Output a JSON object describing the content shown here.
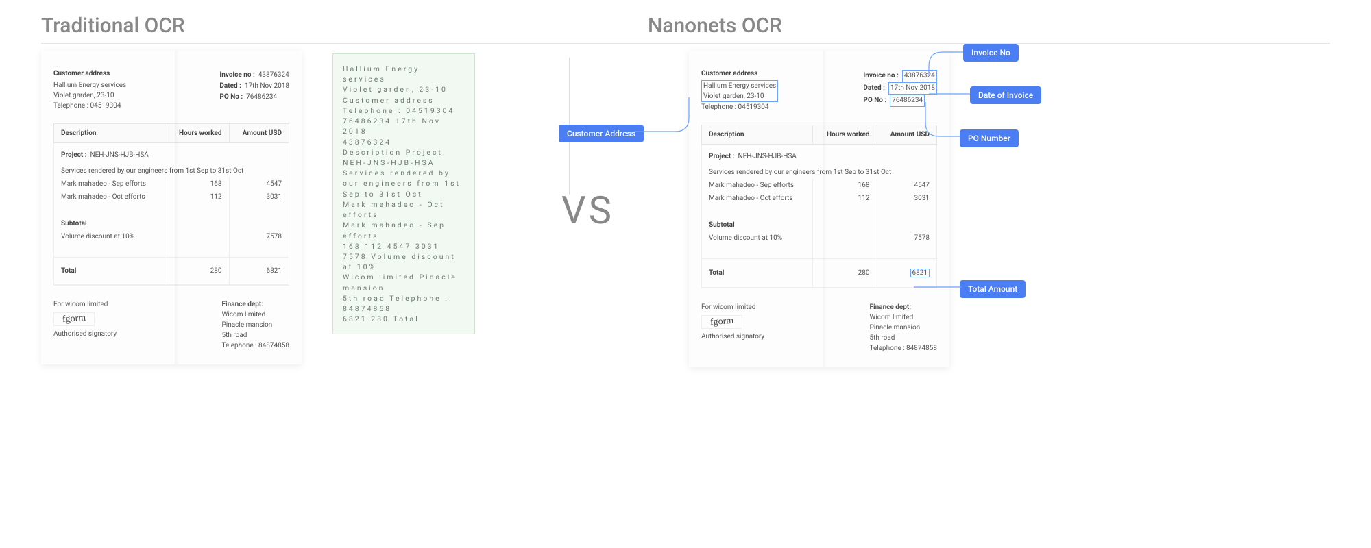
{
  "headings": {
    "left": "Traditional OCR",
    "right": "Nanonets OCR"
  },
  "vs": "VS",
  "invoice": {
    "customer_title": "Customer address",
    "addr1": "Hallium Energy services",
    "addr2": "Violet garden, 23-10",
    "addr3": "Telephone : 04519304",
    "k_invno": "Invoice no :",
    "v_invno": "43876324",
    "k_dated": "Dated :",
    "v_dated": "17th Nov 2018",
    "k_pono": "PO No :",
    "v_pono": "76486234",
    "th_desc": "Description",
    "th_hours": "Hours worked",
    "th_amount": "Amount USD",
    "proj_lbl": "Project :",
    "proj_val": "NEH-JNS-HJB-HSA",
    "proj_desc": "Services rendered by our engineers from 1st Sep to 31st Oct",
    "rows": [
      {
        "desc": "Mark mahadeo - Sep efforts",
        "hours": "168",
        "amount": "4547"
      },
      {
        "desc": "Mark mahadeo - Oct efforts",
        "hours": "112",
        "amount": "3031"
      }
    ],
    "subtotal_lbl": "Subtotal",
    "discount_lbl": "Volume discount at 10%",
    "discount_val": "7578",
    "total_lbl": "Total",
    "total_hours": "280",
    "total_amount": "6821",
    "for_line": "For wicom limited",
    "auth_line": "Authorised signatory",
    "fin_title": "Finance dept:",
    "fin1": "Wicom limited",
    "fin2": "Pinacle mansion",
    "fin3": "5th road",
    "fin4": "Telephone : 84874858"
  },
  "ocr_raw": "Hallium Energy services\nViolet garden, 23-10\nCustomer address\nTelephone : 04519304\n76486234 17th Nov 2018\n43876324\nDescription Project\nNEH-JNS-HJB-HSA\nServices rendered by our engineers from 1st Sep to 31st Oct\nMark mahadeo - Oct efforts\nMark mahadeo - Sep efforts\n168 112 4547 3031\n7578 Volume discount at 10%\nWicom limited Pinacle mansion\n5th road Telephone : 84874858\n6821 280 Total",
  "tags": {
    "cust": "Customer Address",
    "invno": "Invoice No",
    "date": "Date of Invoice",
    "pono": "PO Number",
    "total": "Total Amount"
  }
}
